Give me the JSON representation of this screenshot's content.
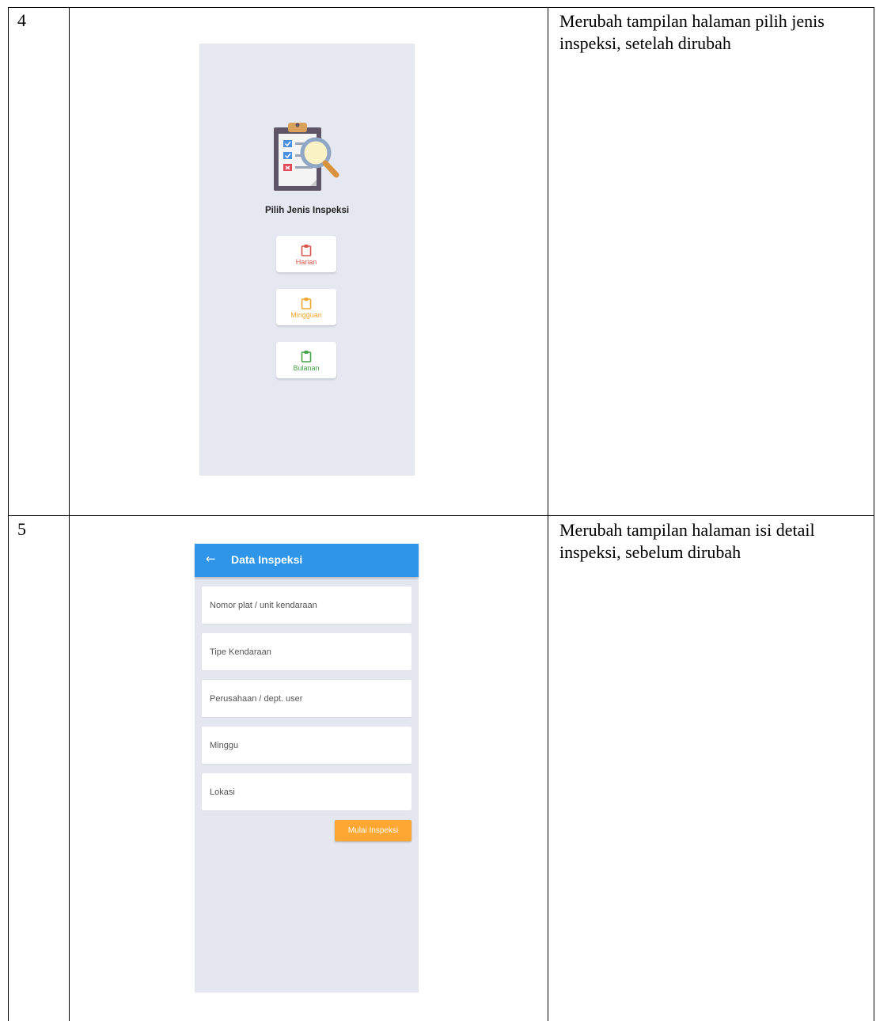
{
  "rows": [
    {
      "number": "4",
      "description": "Merubah tampilan halaman pilih jenis inspeksi, setelah dirubah",
      "screen": {
        "title": "Pilih Jenis Inspeksi",
        "illustration_icon": "clipboard-magnifier-icon",
        "options": [
          {
            "label": "Harian",
            "color": "#d9534f",
            "icon": "clipboard-icon"
          },
          {
            "label": "Mingguan",
            "color": "#f0a830",
            "icon": "clipboard-icon"
          },
          {
            "label": "Bulanan",
            "color": "#45a349",
            "icon": "clipboard-icon"
          }
        ]
      }
    },
    {
      "number": "5",
      "description": "Merubah tampilan halaman isi detail inspeksi, sebelum dirubah",
      "screen": {
        "appbar_title": "Data Inspeksi",
        "back_icon": "arrow-left-icon",
        "appbar_color": "#2e95e8",
        "fields": [
          {
            "placeholder": "Nomor plat / unit kendaraan"
          },
          {
            "placeholder": "Tipe Kendaraan"
          },
          {
            "placeholder": "Perusahaan / dept. user"
          },
          {
            "placeholder": "Minggu"
          },
          {
            "placeholder": "Lokasi"
          }
        ],
        "submit_label": "Mulai Inspeksi",
        "submit_color": "#ffa733"
      }
    }
  ]
}
